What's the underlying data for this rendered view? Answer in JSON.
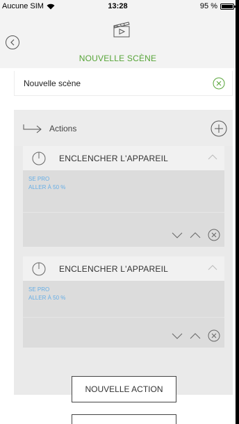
{
  "status_bar": {
    "carrier": "Aucune SIM",
    "time": "13:28",
    "battery": "95 %"
  },
  "header": {
    "title": "NOUVELLE SCÈNE"
  },
  "scene_name": {
    "value": "Nouvelle scène"
  },
  "actions": {
    "title": "Actions",
    "items": [
      {
        "title": "ENCLENCHER L'APPAREIL",
        "device": "SE PRO",
        "command": "ALLER À 50 %"
      },
      {
        "title": "ENCLENCHER L'APPAREIL",
        "device": "SE PRO",
        "command": "ALLER À 50 %"
      }
    ]
  },
  "buttons": {
    "new_action": "NOUVELLE ACTION"
  },
  "colors": {
    "accent_green": "#56a437",
    "detail_blue": "#66aee6",
    "panel_gray": "#eaeaea"
  }
}
